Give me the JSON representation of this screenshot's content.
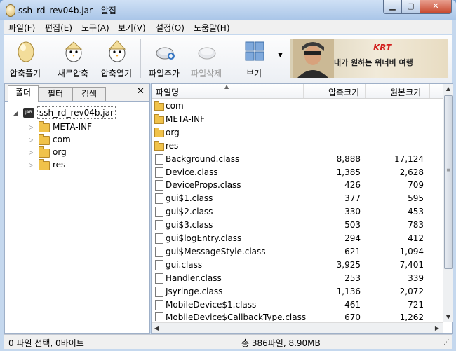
{
  "window": {
    "title": "ssh_rd_rev04b.jar - 알집"
  },
  "menu": [
    "파일(F)",
    "편집(E)",
    "도구(A)",
    "보기(V)",
    "설정(O)",
    "도움말(H)"
  ],
  "toolbar": {
    "extract": "압축풀기",
    "new_archive": "새로압축",
    "open_archive": "압축열기",
    "add_file": "파일추가",
    "delete_file": "파일삭제",
    "view": "보기"
  },
  "ad": {
    "logo": "KRT",
    "text": "내가 원하는 워너비 여행"
  },
  "tabs": [
    "폴더",
    "필터",
    "검색"
  ],
  "tree": {
    "root": "ssh_rd_rev04b.jar",
    "jar_badge": "JAR",
    "children": [
      "META-INF",
      "com",
      "org",
      "res"
    ]
  },
  "columns": {
    "name": "파일명",
    "compressed": "압축크기",
    "original": "원본크기"
  },
  "folders": [
    "com",
    "META-INF",
    "org",
    "res"
  ],
  "files": [
    {
      "name": "Background.class",
      "compressed": "8,888",
      "original": "17,124"
    },
    {
      "name": "Device.class",
      "compressed": "1,385",
      "original": "2,628"
    },
    {
      "name": "DeviceProps.class",
      "compressed": "426",
      "original": "709"
    },
    {
      "name": "gui$1.class",
      "compressed": "377",
      "original": "595"
    },
    {
      "name": "gui$2.class",
      "compressed": "330",
      "original": "453"
    },
    {
      "name": "gui$3.class",
      "compressed": "503",
      "original": "783"
    },
    {
      "name": "gui$logEntry.class",
      "compressed": "294",
      "original": "412"
    },
    {
      "name": "gui$MessageStyle.class",
      "compressed": "621",
      "original": "1,094"
    },
    {
      "name": "gui.class",
      "compressed": "3,925",
      "original": "7,401"
    },
    {
      "name": "Handler.class",
      "compressed": "253",
      "original": "339"
    },
    {
      "name": "Jsyringe.class",
      "compressed": "1,136",
      "original": "2,072"
    },
    {
      "name": "MobileDevice$1.class",
      "compressed": "461",
      "original": "721"
    },
    {
      "name": "MobileDevice$CallbackType.class",
      "compressed": "670",
      "original": "1,262"
    }
  ],
  "status": {
    "selection": "0 파일 선택, 0바이트",
    "total": "총 386파일, 8.90MB"
  },
  "colors": {
    "accent": "#3a78c3",
    "titlebar": "#aac6e8",
    "close": "#c7462c"
  }
}
